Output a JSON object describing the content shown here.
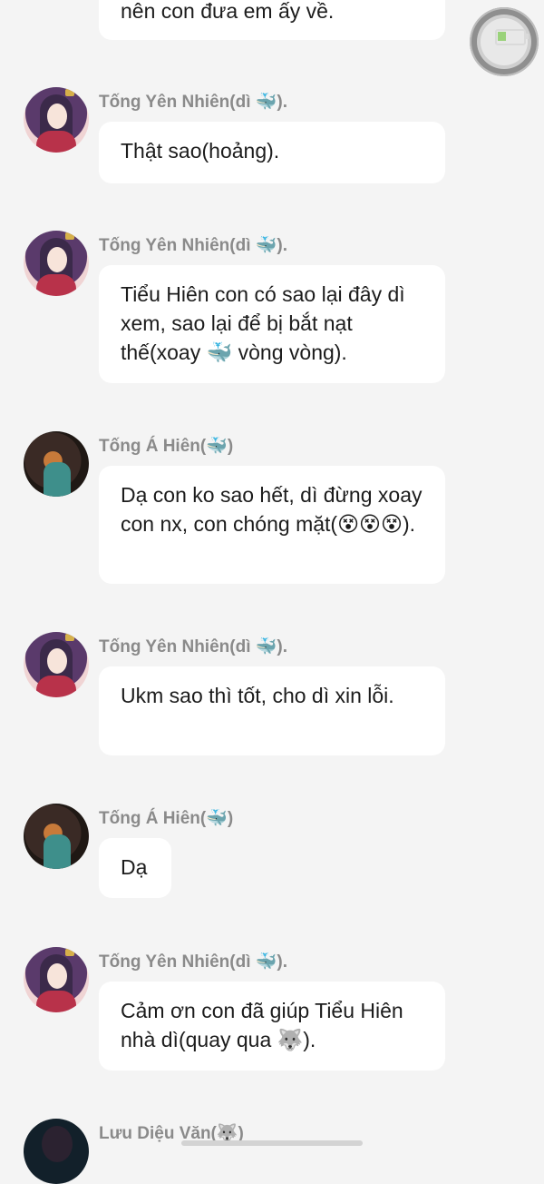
{
  "messages": [
    {
      "sender": "",
      "avatar": "",
      "text": "nên con đưa em ấy về."
    },
    {
      "sender": "Tống Yên Nhiên(dì 🐳).",
      "avatar": "female-avatar",
      "text": "Thật sao(hoảng)."
    },
    {
      "sender": "Tống Yên Nhiên(dì 🐳).",
      "avatar": "female-avatar",
      "text": "Tiểu Hiên con có sao lại đây dì xem, sao lại để bị bắt nạt thế(xoay 🐳 vòng vòng)."
    },
    {
      "sender": "Tống Á Hiên(🐳)",
      "avatar": "male-avatar",
      "text": "Dạ con ko sao hết, dì đừng xoay con nx, con chóng mặt(😵😵😵)."
    },
    {
      "sender": "Tống Yên Nhiên(dì 🐳).",
      "avatar": "female-avatar",
      "text": "Ukm sao thì tốt, cho dì xin lỗi."
    },
    {
      "sender": "Tống Á Hiên(🐳)",
      "avatar": "male-avatar",
      "text": "Dạ"
    },
    {
      "sender": "Tống Yên Nhiên(dì 🐳).",
      "avatar": "female-avatar",
      "text": "Cảm ơn con đã giúp Tiểu Hiên nhà dì(quay qua 🐺)."
    },
    {
      "sender": "Lưu Diệu Văn(🐺)",
      "avatar": "dark-avatar",
      "text": ""
    }
  ],
  "icons": {
    "floating_button": "assistive-touch-icon",
    "battery": "battery-icon"
  },
  "colors": {
    "background": "#f4f4f4",
    "bubble": "#ffffff",
    "sender": "#8a8a8a",
    "text": "#1c1c1c"
  }
}
